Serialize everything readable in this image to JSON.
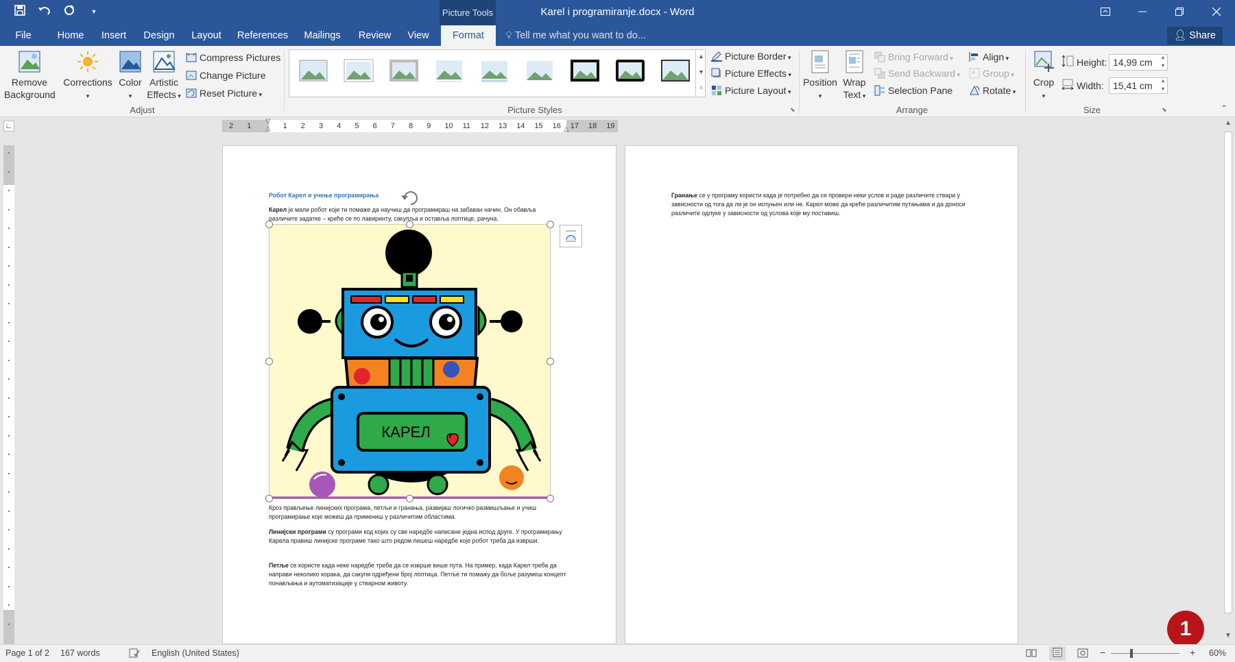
{
  "window": {
    "title": "Karel i programiranje.docx - Word",
    "context_tools_label": "Picture Tools",
    "qat": {
      "save_icon": "save-icon",
      "undo_icon": "undo-icon",
      "redo_icon": "redo-icon",
      "customize_icon": "customize-qat-icon"
    }
  },
  "tabs": {
    "file": "File",
    "home": "Home",
    "insert": "Insert",
    "design": "Design",
    "layout": "Layout",
    "references": "References",
    "mailings": "Mailings",
    "review": "Review",
    "view": "View",
    "format": "Format",
    "tell_me": "Tell me what you want to do...",
    "share": "Share"
  },
  "ribbon": {
    "adjust": {
      "label": "Adjust",
      "remove_background_1": "Remove",
      "remove_background_2": "Background",
      "corrections": "Corrections",
      "color": "Color",
      "artistic_1": "Artistic",
      "artistic_2": "Effects",
      "compress": "Compress Pictures",
      "change": "Change Picture",
      "reset": "Reset Picture"
    },
    "styles": {
      "label": "Picture Styles",
      "border": "Picture Border",
      "effects": "Picture Effects",
      "layout": "Picture Layout"
    },
    "arrange": {
      "label": "Arrange",
      "position": "Position",
      "wrap_1": "Wrap",
      "wrap_2": "Text",
      "bring_forward": "Bring Forward",
      "send_backward": "Send Backward",
      "selection_pane": "Selection Pane",
      "align": "Align",
      "group": "Group",
      "rotate": "Rotate"
    },
    "size": {
      "label": "Size",
      "crop": "Crop",
      "height_label": "Height:",
      "height_value": "14,99 cm",
      "width_label": "Width:",
      "width_value": "15,41 cm"
    }
  },
  "ruler": {
    "labels": [
      "2",
      "1",
      "",
      "1",
      "2",
      "3",
      "4",
      "5",
      "6",
      "7",
      "8",
      "9",
      "10",
      "11",
      "12",
      "13",
      "14",
      "15",
      "16",
      "17",
      "18",
      "19"
    ]
  },
  "document": {
    "heading": "Робот Карел и учење програмирања",
    "p1_bold": "Карел",
    "p1_rest": " је мали робот који ти помаже да научиш да програмираш на забаван начин. Он обавља различите задатке – креће се по лавиринту, сакупља и оставља лоптице, рачуна.",
    "p2": "Кроз прављење линијских програма, петљи и гранања, развијаш логичко размишљање и учиш програмирање које можеш да примениш у различитим областима.",
    "p3_bold": "Линијски програми",
    "p3_rest": " су програми код којих су све наредбе написане једна испод друге. У програмирању Карела правиш линијске програме тако што редом пишеш наредбе које робот треба да изврши.",
    "p4_bold": "Петље",
    "p4_rest": " се користе када неке наредбе треба да се изврше више пута. На пример, када Карел треба да направи неколико корака, да сакупи одређени број лоптица. Петље ти помажу да боље разумеш концепт понављања и аутоматизације у стварном животу.",
    "p5_bold": "Гранање",
    "p5_rest": " се у програму користи када је потребно да се провери неки услов и раде различите ствари у зависности од тога да ли је он испуњен или не. Карел може да креће различитим путањама и да доноси различите одлуке у зависности од услова које му поставиш.",
    "robot_label": "КАРЕЛ"
  },
  "status": {
    "page": "Page 1 of 2",
    "words": "167 words",
    "language": "English (United States)",
    "zoom": "60%",
    "zoom_minus": "−",
    "zoom_plus": "+"
  },
  "badge": "1"
}
